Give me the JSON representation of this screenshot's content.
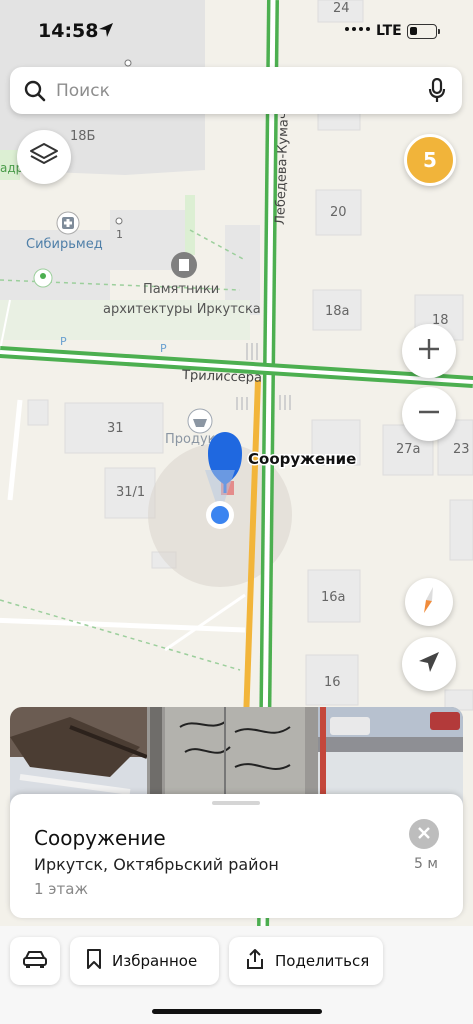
{
  "status_bar": {
    "time": "14:58",
    "network": "LTE",
    "battery_percent": 20
  },
  "search": {
    "placeholder": "Поиск"
  },
  "traffic": {
    "level": "5",
    "color": "#f1b43a"
  },
  "map": {
    "streets": [
      "Лебедева-Кумача",
      "Трилиссера"
    ],
    "poi": {
      "sibirmed": "Сибирьмед",
      "monuments_line1": "Памятники",
      "monuments_line2": "архитектуры Иркутска",
      "products": "Продук",
      "place_label": "Сооружение",
      "left_edge": "адр"
    },
    "buildings": [
      "24",
      "18Б",
      "20",
      "18а",
      "18",
      "31",
      "31/1",
      "27а",
      "23",
      "16а",
      "16",
      "1"
    ],
    "parking": "P",
    "accent_colors": {
      "road_green": "#4caf50",
      "road_yellow": "#f2b53a",
      "pin_blue": "#1f68e0",
      "compass_orange": "#f08b3a"
    }
  },
  "card": {
    "title": "Сооружение",
    "address": "Иркутск, Октябрьский район",
    "floor": "1 этаж",
    "distance": "5 м"
  },
  "actions": {
    "car": "car-icon",
    "favorites": "Избранное",
    "share": "Поделиться"
  }
}
